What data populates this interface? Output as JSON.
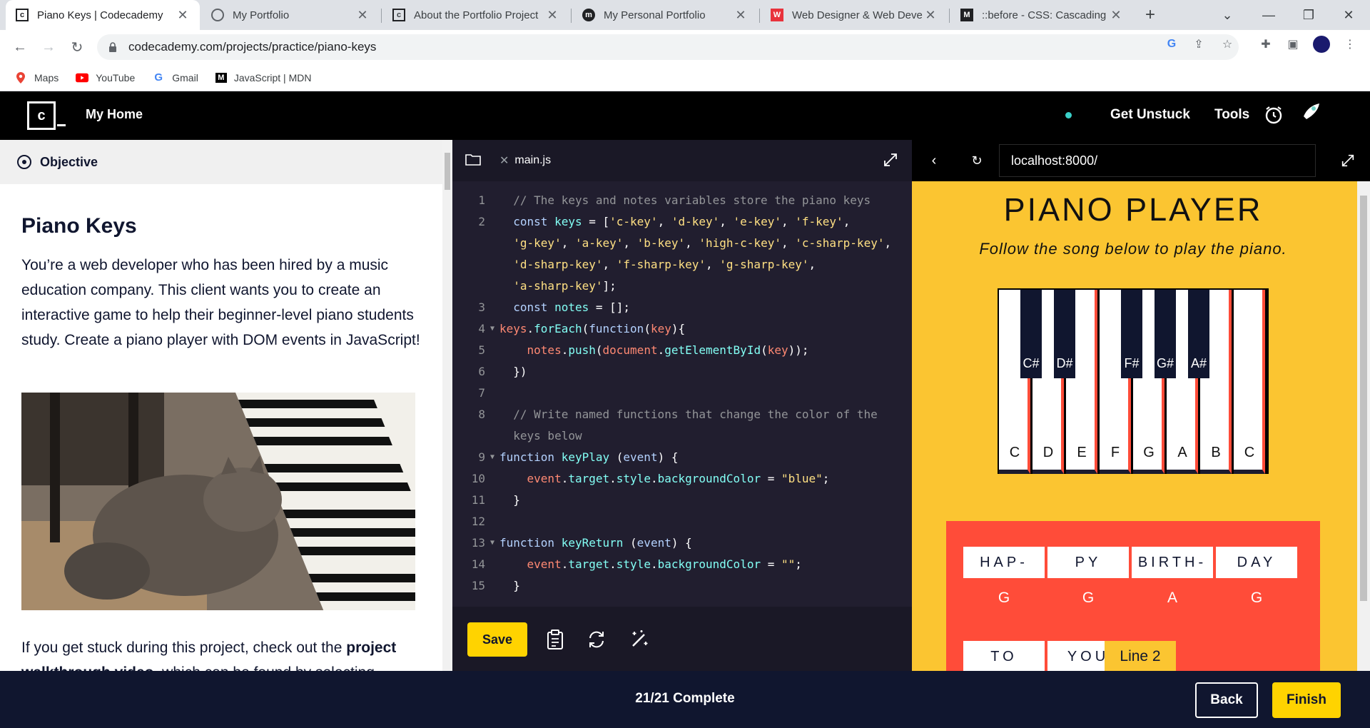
{
  "browser": {
    "tabs": [
      {
        "title": "Piano Keys | Codecademy",
        "favicon": "codecademy-icon",
        "active": true
      },
      {
        "title": "My Portfolio",
        "favicon": "globe-icon",
        "active": false
      },
      {
        "title": "About the Portfolio Project",
        "favicon": "codecademy-icon",
        "active": false
      },
      {
        "title": "My Personal Portfolio",
        "favicon": "portfolio-icon",
        "active": false
      },
      {
        "title": "Web Designer & Web Deve",
        "favicon": "w-icon",
        "active": false
      },
      {
        "title": "::before - CSS: Cascading St",
        "favicon": "mdn-icon",
        "active": false
      }
    ],
    "url": "codecademy.com/projects/practice/piano-keys",
    "bookmarks": [
      {
        "label": "Maps",
        "icon": "maps-icon"
      },
      {
        "label": "YouTube",
        "icon": "youtube-icon"
      },
      {
        "label": "Gmail",
        "icon": "google-icon"
      },
      {
        "label": "JavaScript | MDN",
        "icon": "mdn-icon"
      }
    ]
  },
  "header": {
    "logo_text": "c",
    "home_label": "My Home",
    "get_unstuck": "Get Unstuck",
    "tools": "Tools"
  },
  "instructions": {
    "section_label": "Objective",
    "title": "Piano Keys",
    "body": "You’re a web developer who has been hired by a music education company. This client wants you to create an interactive game to help their beginner-level piano students study. Create a piano player with DOM events in JavaScript!",
    "stuck_prefix": "If you get stuck during this project, check out the ",
    "stuck_bold": "project walkthrough video",
    "stuck_suffix": ", which can be found by selecting"
  },
  "editor": {
    "file_name": "main.js",
    "save_label": "Save"
  },
  "preview": {
    "url": "localhost:8000/",
    "title": "PIANO PLAYER",
    "subtitle": "Follow the song below to play the piano.",
    "white_keys": [
      "C",
      "D",
      "E",
      "F",
      "G",
      "A",
      "B",
      "C"
    ],
    "black_keys": [
      "C#",
      "D#",
      "F#",
      "G#",
      "A#"
    ],
    "song_line1": {
      "words": [
        "HAP-",
        "PY",
        "BIRTH-",
        "DAY"
      ],
      "notes": [
        "G",
        "G",
        "A",
        "G"
      ]
    },
    "song_line2": {
      "words": [
        "TO",
        "YOU"
      ]
    },
    "line2_button": "Line 2"
  },
  "footer": {
    "progress": "21/21 Complete",
    "back_label": "Back",
    "finish_label": "Finish"
  },
  "colors": {
    "codecademy_yellow": "#ffd300",
    "preview_background": "#fbc531",
    "song_box": "#ff4c39",
    "editor_background": "#211e2f",
    "navy": "#10162f"
  }
}
